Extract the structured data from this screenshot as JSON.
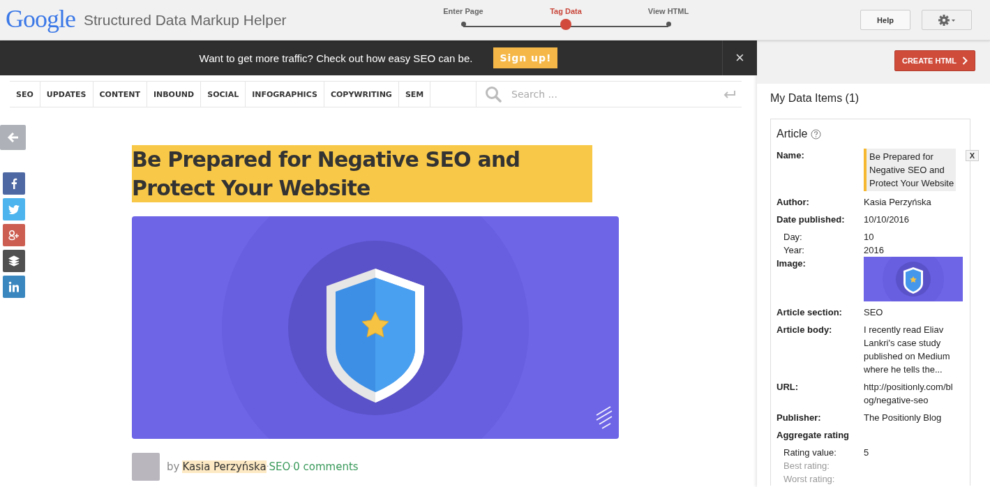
{
  "header": {
    "logo": "Google",
    "title": "Structured Data Markup Helper",
    "steps": [
      {
        "label": "Enter Page",
        "selected": false
      },
      {
        "label": "Tag Data",
        "selected": true
      },
      {
        "label": "View HTML",
        "selected": false
      }
    ],
    "help": "Help"
  },
  "banner": {
    "text": "Want to get more traffic? Check out how easy SEO can be.",
    "button": "Sign up!",
    "close": "×"
  },
  "nav": {
    "items": [
      "SEO",
      "UPDATES",
      "CONTENT",
      "INBOUND",
      "SOCIAL",
      "INFOGRAPHICS",
      "COPYWRITING",
      "SEM"
    ],
    "search": {
      "placeholder": "Search ..."
    }
  },
  "article": {
    "title": "Be Prepared for Negative SEO and Protect Your Website",
    "byline": [
      {
        "text": "by",
        "kind": "plain"
      },
      {
        "text": "Kasia Perzyńska",
        "kind": "tagged"
      },
      {
        "text": "·",
        "kind": "sep"
      },
      {
        "text": "SEO",
        "kind": "link"
      },
      {
        "text": "·",
        "kind": "sep"
      },
      {
        "text": "0 comments",
        "kind": "link"
      }
    ]
  },
  "panel": {
    "create_button": "CREATE HTML",
    "items_title": "My Data Items (1)",
    "card_title": "Article",
    "remove": "X",
    "fields": [
      {
        "label": "Name:",
        "value": "Be Prepared for Negative SEO and Protect Your Website",
        "kind": "highlight",
        "disabled": false
      },
      {
        "label": "Author:",
        "value": "Kasia Perzyńska",
        "kind": "text",
        "disabled": false
      },
      {
        "label": "Date published:",
        "value": "10/10/2016",
        "kind": "text",
        "disabled": false
      },
      {
        "label": "Day:",
        "value": "10",
        "kind": "sub",
        "disabled": false
      },
      {
        "label": "Year:",
        "value": "2016",
        "kind": "sub",
        "disabled": false
      },
      {
        "label": "Image:",
        "kind": "image",
        "disabled": false
      },
      {
        "label": "Article section:",
        "value": "SEO",
        "kind": "text",
        "disabled": false
      },
      {
        "label": "Article body:",
        "value": "I recently read Eliav Lankri's case study published on Medium where he tells the...",
        "kind": "text",
        "disabled": false
      },
      {
        "label": "URL:",
        "value": "http://positionly.com/blog/negative-seo",
        "kind": "text",
        "disabled": false
      },
      {
        "label": "Publisher:",
        "value": "The Positionly Blog",
        "kind": "text",
        "disabled": false
      },
      {
        "label": "Aggregate rating",
        "kind": "group",
        "disabled": false
      },
      {
        "label": "Rating value:",
        "value": "5",
        "kind": "sub",
        "disabled": false
      },
      {
        "label": "Best rating:",
        "kind": "sub",
        "disabled": true
      },
      {
        "label": "Worst rating:",
        "kind": "sub",
        "disabled": true
      }
    ]
  }
}
